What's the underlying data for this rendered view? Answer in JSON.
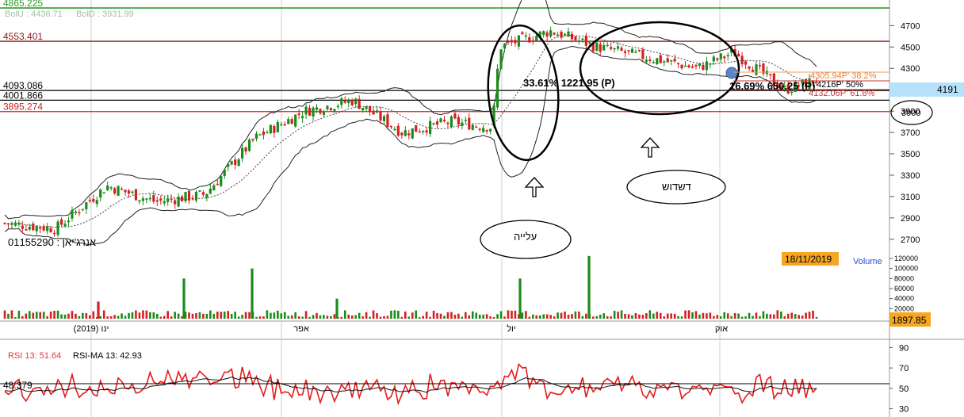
{
  "header": {
    "bol_u": "BolU : 4436.71",
    "bol_d": "BolD : 3931.99",
    "symbol": "אנרג'יאן : 01155290"
  },
  "price_levels": [
    {
      "label": "4865.225",
      "value": 4865.225,
      "color": "#2e9a2e"
    },
    {
      "label": "4553.401",
      "value": 4553.401,
      "color": "#8b1a1a"
    },
    {
      "label": "4093.086",
      "value": 4093.086,
      "color": "#000000"
    },
    {
      "label": "4001.866",
      "value": 4001.866,
      "color": "#000000"
    },
    {
      "label": "3895.274",
      "value": 3895.274,
      "color": "#cc2222"
    }
  ],
  "current_price": "4191",
  "circled_level": "3900",
  "annotations": {
    "rise_pct": "33.61% 1221.95 (P)",
    "fall_pct": "16.69% 650.25 (P)",
    "fib_382": "4305.94P' 38.2%",
    "fib_50": "4216P' 50%",
    "fib_618": "4132.06P' 61.8%",
    "rise_label": "עלייה",
    "consolidation_label": "דשדוש"
  },
  "volume_panel": {
    "date_box": "18/11/2019",
    "title": "Volume",
    "last_value": "1897.85",
    "ticks": [
      "120000",
      "100000",
      "80000",
      "60000",
      "40000",
      "20000"
    ]
  },
  "rsi_panel": {
    "rsi_label": "RSI 13: 51.64",
    "rsi_ma_label": "RSI-MA 13: 42.93",
    "left_value": "48.379",
    "ticks": [
      "90",
      "70",
      "50",
      "30"
    ]
  },
  "x_axis_labels": [
    "ינו (2019)",
    "אפר",
    "יול",
    "אוק"
  ],
  "chart_data": {
    "type": "candlestick",
    "y_axis_ticks": [
      4700,
      4500,
      4300,
      4100,
      3900,
      3700,
      3500,
      3300,
      3100,
      2900,
      2700
    ],
    "ylim": [
      2580,
      4910
    ],
    "x_months": [
      "2019-01",
      "2019-04",
      "2019-07",
      "2019-10"
    ],
    "close_series": [
      {
        "x": "2018-12-20",
        "y": 2850
      },
      {
        "x": "2019-01-10",
        "y": 2800
      },
      {
        "x": "2019-01-31",
        "y": 3200
      },
      {
        "x": "2019-02-20",
        "y": 3050
      },
      {
        "x": "2019-03-12",
        "y": 3120
      },
      {
        "x": "2019-04-02",
        "y": 3650
      },
      {
        "x": "2019-04-22",
        "y": 3900
      },
      {
        "x": "2019-05-12",
        "y": 4000
      },
      {
        "x": "2019-06-01",
        "y": 3700
      },
      {
        "x": "2019-06-21",
        "y": 3800
      },
      {
        "x": "2019-07-08",
        "y": 3750
      },
      {
        "x": "2019-07-11",
        "y": 4500
      },
      {
        "x": "2019-08-01",
        "y": 4650
      },
      {
        "x": "2019-08-20",
        "y": 4500
      },
      {
        "x": "2019-09-10",
        "y": 4400
      },
      {
        "x": "2019-09-30",
        "y": 4300
      },
      {
        "x": "2019-10-15",
        "y": 4450
      },
      {
        "x": "2019-11-05",
        "y": 4100
      },
      {
        "x": "2019-11-18",
        "y": 4191
      }
    ],
    "volume": {
      "ylim": [
        0,
        120000
      ],
      "highlight_bars": [
        80000,
        100000,
        40000,
        80000,
        125000
      ]
    },
    "rsi": {
      "ylim": [
        25,
        95
      ],
      "last": 51.64,
      "ma_last": 42.93
    }
  }
}
